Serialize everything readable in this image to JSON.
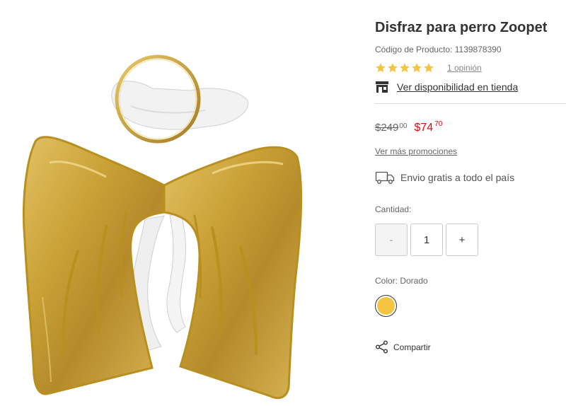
{
  "product": {
    "title": "Disfraz para perro Zoopet",
    "code_label": "Código de Producto:",
    "code_value": "1139878390",
    "image_icon": "angel-wings-costume-image"
  },
  "rating": {
    "stars": 5,
    "star_icon": "star-icon",
    "reviews_text": "1 opinión"
  },
  "store": {
    "icon": "store-icon",
    "label": "Ver disponibilidad en tienda"
  },
  "price": {
    "old_whole": "$249",
    "old_cents": "00",
    "new_whole": "$74",
    "new_cents": "70"
  },
  "promotions": {
    "label": "Ver más promociones"
  },
  "shipping": {
    "icon": "truck-icon",
    "label": "Envio gratis a todo el país"
  },
  "quantity": {
    "label": "Cantidad:",
    "minus": "-",
    "value": "1",
    "plus": "+"
  },
  "color": {
    "label": "Color: Dorado",
    "swatch": "#F5C542"
  },
  "share": {
    "icon": "share-icon",
    "label": "Compartir"
  },
  "colors": {
    "star": "#F5C542",
    "sale_price": "#E30613",
    "text": "#333333",
    "muted": "#666666",
    "gold": "#C9A136"
  }
}
